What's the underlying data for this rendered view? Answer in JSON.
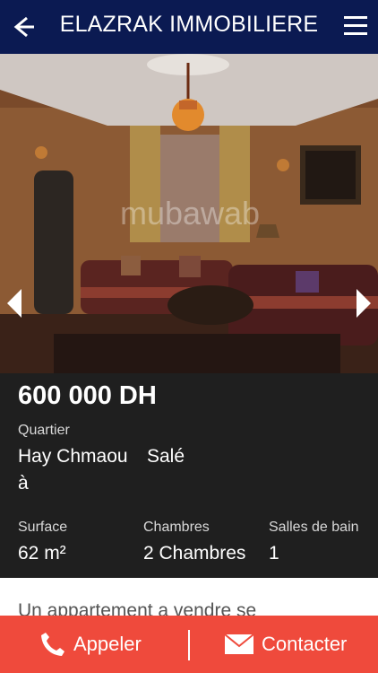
{
  "header": {
    "title": "ELAZRAK IMMOBILIERE"
  },
  "listing": {
    "price": "600 000 DH",
    "quartier_label": "Quartier",
    "quartier_value_1": "Hay Chmaou",
    "quartier_value_2": "Salé",
    "quartier_value_3": "à",
    "surface_label": "Surface",
    "surface_value": "62 m²",
    "chambres_label": "Chambres",
    "chambres_value": "2 Chambres",
    "salles_label": "Salles de bain",
    "salles_value": "1",
    "description_partial": "Un appartement a vendre se"
  },
  "image": {
    "watermark": "mubawab"
  },
  "actions": {
    "call_label": "Appeler",
    "contact_label": "Contacter"
  },
  "colors": {
    "topbar": "#0b1a52",
    "bottombar": "#ef4a3c",
    "infopanel": "#1f1f1f"
  }
}
